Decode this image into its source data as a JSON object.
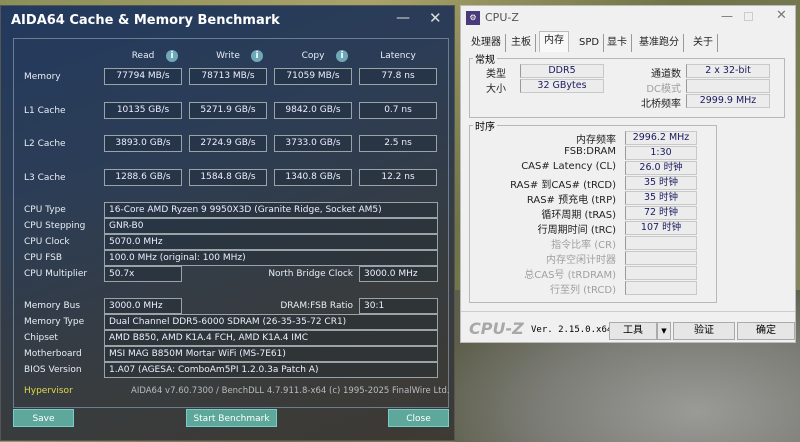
{
  "aida": {
    "title": "AIDA64 Cache & Memory Benchmark",
    "columns": [
      "Read",
      "Write",
      "Copy",
      "Latency"
    ],
    "rows": [
      {
        "label": "Memory",
        "values": [
          "77794 MB/s",
          "78713 MB/s",
          "71059 MB/s",
          "77.8 ns"
        ]
      },
      {
        "label": "L1 Cache",
        "values": [
          "10135 GB/s",
          "5271.9 GB/s",
          "9842.0 GB/s",
          "0.7 ns"
        ]
      },
      {
        "label": "L2 Cache",
        "values": [
          "3893.0 GB/s",
          "2724.9 GB/s",
          "3733.0 GB/s",
          "2.5 ns"
        ]
      },
      {
        "label": "L3 Cache",
        "values": [
          "1288.6 GB/s",
          "1584.8 GB/s",
          "1340.8 GB/s",
          "12.2 ns"
        ]
      }
    ],
    "info": {
      "cpu_type": {
        "label": "CPU Type",
        "value": "16-Core AMD Ryzen 9 9950X3D  (Granite Ridge, Socket AM5)"
      },
      "cpu_stepping": {
        "label": "CPU Stepping",
        "value": "GNR-B0"
      },
      "cpu_clock": {
        "label": "CPU Clock",
        "value": "5070.0 MHz"
      },
      "cpu_fsb": {
        "label": "CPU FSB",
        "value": "100.0 MHz  (original: 100 MHz)"
      },
      "cpu_multiplier": {
        "label": "CPU Multiplier",
        "value": "50.7x"
      },
      "nb_clock": {
        "label": "North Bridge Clock",
        "value": "3000.0 MHz"
      },
      "memory_bus": {
        "label": "Memory Bus",
        "value": "3000.0 MHz"
      },
      "dram_fsb": {
        "label": "DRAM:FSB Ratio",
        "value": "30:1"
      },
      "memory_type": {
        "label": "Memory Type",
        "value": "Dual Channel DDR5-6000 SDRAM  (26-35-35-72 CR1)"
      },
      "chipset": {
        "label": "Chipset",
        "value": "AMD B850, AMD K1A.4 FCH, AMD K1A.4 IMC"
      },
      "motherboard": {
        "label": "Motherboard",
        "value": "MSI MAG B850M Mortar WiFi (MS-7E61)"
      },
      "bios": {
        "label": "BIOS Version",
        "value": "1.A07  (AGESA: ComboAm5PI 1.2.0.3a Patch A)"
      }
    },
    "hypervisor": "Hypervisor",
    "footer": "AIDA64 v7.60.7300 / BenchDLL 4.7.911.8-x64  (c) 1995-2025 FinalWire Ltd.",
    "buttons": {
      "save": "Save",
      "start": "Start Benchmark",
      "close": "Close"
    }
  },
  "cpuz": {
    "title": "CPU-Z",
    "tabs": [
      "处理器",
      "主板",
      "内存",
      "SPD",
      "显卡",
      "基准跑分",
      "关于"
    ],
    "general": {
      "title": "常规",
      "type_label": "类型",
      "type": "DDR5",
      "size_label": "大小",
      "size": "32 GBytes",
      "channels_label": "通道数",
      "channels": "2 x 32-bit",
      "dc_label": "DC模式",
      "nb_label": "北桥频率",
      "nb": "2999.9 MHz"
    },
    "timings": {
      "title": "时序",
      "items": [
        {
          "label": "内存频率",
          "value": "2996.2 MHz"
        },
        {
          "label": "FSB:DRAM",
          "value": "1:30"
        },
        {
          "label": "CAS# Latency (CL)",
          "value": "26.0 时钟"
        },
        {
          "label": "RAS# 到CAS# (tRCD)",
          "value": "35 时钟"
        },
        {
          "label": "RAS# 预充电 (tRP)",
          "value": "35 时钟"
        },
        {
          "label": "循环周期 (tRAS)",
          "value": "72 时钟"
        },
        {
          "label": "行周期时间 (tRC)",
          "value": "107 时钟"
        },
        {
          "label": "指令比率 (CR)",
          "value": ""
        },
        {
          "label": "内存空闲计时器",
          "value": ""
        },
        {
          "label": "总CAS号 (tRDRAM)",
          "value": ""
        },
        {
          "label": "行至列 (tRCD)",
          "value": ""
        }
      ]
    },
    "brand": "CPU-Z",
    "version": "Ver. 2.15.0.x64",
    "buttons": {
      "tools": "工具",
      "validate": "验证",
      "ok": "确定"
    }
  }
}
